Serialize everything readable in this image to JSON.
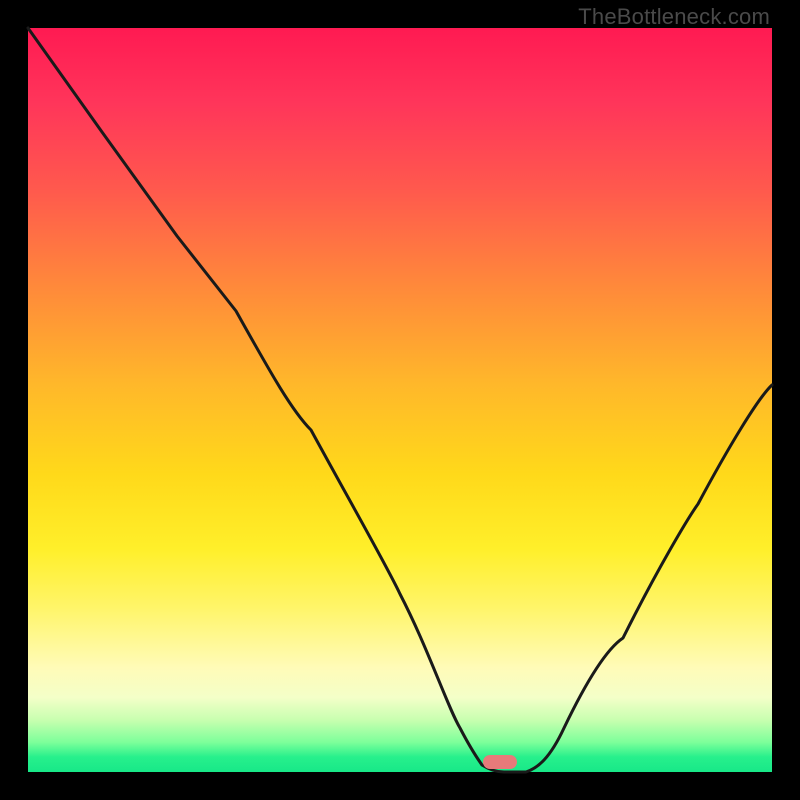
{
  "watermark": "TheBottleneck.com",
  "marker": {
    "color": "#e77a7a",
    "x_frac": 0.635,
    "y_frac": 0.986
  },
  "chart_data": {
    "type": "line",
    "title": "",
    "xlabel": "",
    "ylabel": "",
    "xlim": [
      0,
      100
    ],
    "ylim": [
      0,
      100
    ],
    "series": [
      {
        "name": "bottleneck-curve",
        "x": [
          0,
          10,
          20,
          28,
          38,
          50,
          58,
          61,
          64,
          67,
          72,
          80,
          90,
          100
        ],
        "values": [
          100,
          86,
          72,
          62,
          46,
          24,
          6,
          1,
          0,
          0,
          6,
          18,
          36,
          52
        ]
      }
    ],
    "annotations": [
      {
        "type": "marker",
        "shape": "pill",
        "x": 63.5,
        "y": 0,
        "color": "#e77a7a"
      }
    ],
    "gradient_stops": [
      {
        "pos": 0.0,
        "color": "#ff1a52"
      },
      {
        "pos": 0.35,
        "color": "#ff8a3a"
      },
      {
        "pos": 0.6,
        "color": "#ffd91a"
      },
      {
        "pos": 0.86,
        "color": "#fffbb8"
      },
      {
        "pos": 1.0,
        "color": "#18e888"
      }
    ]
  }
}
